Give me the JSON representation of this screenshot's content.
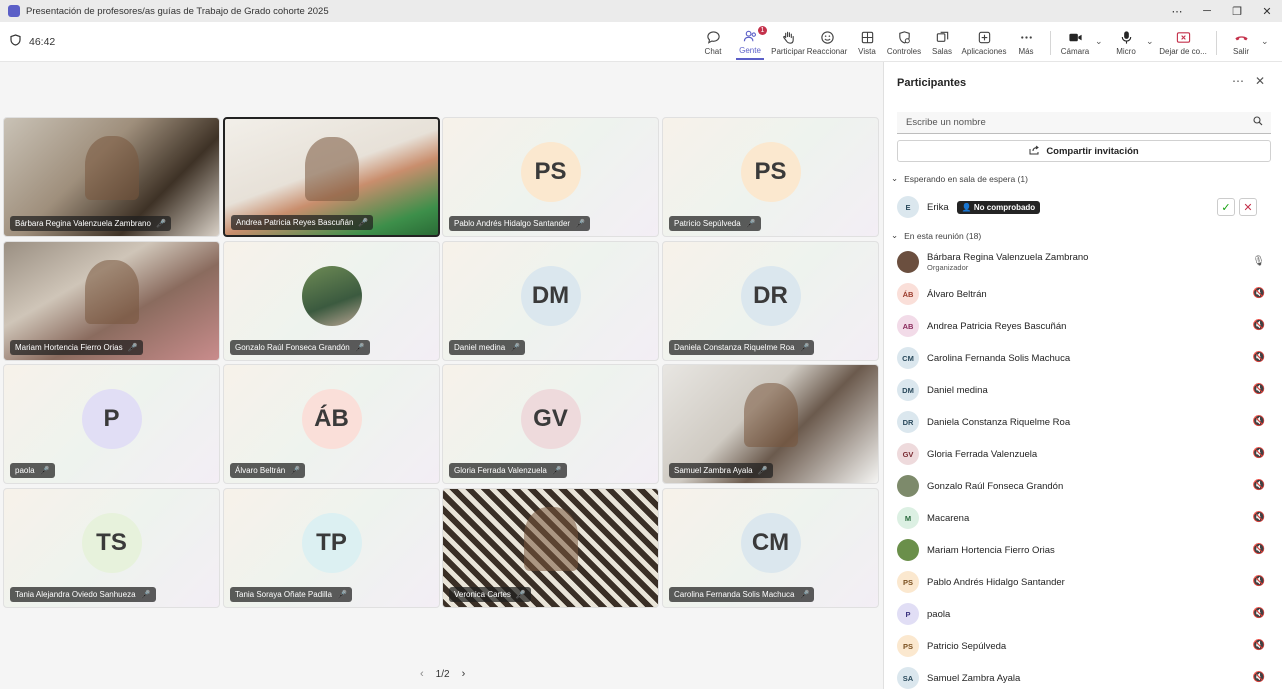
{
  "window": {
    "title": "Presentación de profesores/as guías de Trabajo de Grado cohorte 2025",
    "controls": [
      "⋯",
      "─",
      "❐",
      "✕"
    ]
  },
  "toolbar": {
    "timer": "46:42",
    "chat": "Chat",
    "people": "Gente",
    "people_badge": "1",
    "raise": "Participar",
    "react": "Reaccionar",
    "view": "Vista",
    "controls": "Controles",
    "rooms": "Salas",
    "apps": "Aplicaciones",
    "more": "Más",
    "camera": "Cámara",
    "mic": "Micro",
    "share": "Dejar de co...",
    "leave": "Salir"
  },
  "tiles": [
    {
      "name": "Bárbara Regina Valenzuela Zambrano",
      "initials": "",
      "color": "",
      "photo": "office"
    },
    {
      "name": "Andrea Patricia Reyes Bascuñán",
      "initials": "",
      "color": "",
      "photo": "woman1"
    },
    {
      "name": "Pablo Andrés Hidalgo Santander",
      "initials": "PS",
      "color": "#fbe8cf"
    },
    {
      "name": "Patricio Sepúlveda",
      "initials": "PS",
      "color": "#fbe8cf"
    },
    {
      "name": "Mariam Hortencia Fierro Orias",
      "initials": "",
      "color": "",
      "photo": "woman2"
    },
    {
      "name": "Gonzalo Raúl Fonseca Grandón",
      "initials": "",
      "color": "#e8f3ec",
      "photo": "avatarphoto"
    },
    {
      "name": "Daniel medina",
      "initials": "DM",
      "color": "#dbe7ee"
    },
    {
      "name": "Daniela Constanza Riquelme Roa",
      "initials": "DR",
      "color": "#dbe7ee"
    },
    {
      "name": "paola",
      "initials": "P",
      "color": "#e1def5"
    },
    {
      "name": "Álvaro Beltrán",
      "initials": "ÁB",
      "color": "#fadfd9"
    },
    {
      "name": "Gloria Ferrada Valenzuela",
      "initials": "GV",
      "color": "#eedadc"
    },
    {
      "name": "Samuel Zambra Ayala",
      "initials": "",
      "color": "",
      "photo": "man1"
    },
    {
      "name": "Tania Alejandra Oviedo Sanhueza",
      "initials": "TS",
      "color": "#e7f2dc"
    },
    {
      "name": "Tania Soraya Oñate Padilla",
      "initials": "TP",
      "color": "#dcf0f2"
    },
    {
      "name": "Veronica Cartes",
      "initials": "",
      "color": "",
      "photo": "woman3"
    },
    {
      "name": "Carolina Fernanda Solis Machuca",
      "initials": "CM",
      "color": "#dbe7ee"
    }
  ],
  "pager": {
    "label": "1/2"
  },
  "panel": {
    "title": "Participantes",
    "search_placeholder": "Escribe un nombre",
    "share_invite": "Compartir invitación",
    "waiting_section": "Esperando en sala de espera (1)",
    "waiting": {
      "initials": "E",
      "name": "Erika",
      "badge": "No comprobado"
    },
    "meeting_section": "En esta reunión (18)",
    "participants": [
      {
        "initials": "",
        "name": "Bárbara Regina Valenzuela Zambrano",
        "role": "Organizador",
        "color": "#6b4f3f",
        "photo": true
      },
      {
        "initials": "ÁB",
        "name": "Álvaro Beltrán",
        "color": "#fadfd9",
        "text": "#9a3a2c"
      },
      {
        "initials": "AB",
        "name": "Andrea Patricia Reyes Bascuñán",
        "color": "#f2dbe8",
        "text": "#8a2a5c"
      },
      {
        "initials": "CM",
        "name": "Carolina Fernanda Solis Machuca",
        "color": "#dbe7ee",
        "text": "#2a4a5c"
      },
      {
        "initials": "DM",
        "name": "Daniel medina",
        "color": "#dbe7ee",
        "text": "#2a4a5c"
      },
      {
        "initials": "DR",
        "name": "Daniela Constanza Riquelme Roa",
        "color": "#dbe7ee",
        "text": "#2a4a5c"
      },
      {
        "initials": "GV",
        "name": "Gloria Ferrada Valenzuela",
        "color": "#eedadc",
        "text": "#7a2a32"
      },
      {
        "initials": "",
        "name": "Gonzalo Raúl Fonseca Grandón",
        "color": "#7d8a6b",
        "photo": true
      },
      {
        "initials": "M",
        "name": "Macarena",
        "color": "#dcf0e3",
        "text": "#2a6b3e"
      },
      {
        "initials": "",
        "name": "Mariam Hortencia Fierro Orias",
        "color": "#6a8f4a",
        "photo": true
      },
      {
        "initials": "PS",
        "name": "Pablo Andrés Hidalgo Santander",
        "color": "#fbe8cf",
        "text": "#7a5020"
      },
      {
        "initials": "P",
        "name": "paola",
        "color": "#e1def5",
        "text": "#3d3580"
      },
      {
        "initials": "PS",
        "name": "Patricio Sepúlveda",
        "color": "#fbe8cf",
        "text": "#7a5020"
      },
      {
        "initials": "SA",
        "name": "Samuel Zambra Ayala",
        "color": "#dbe7ee",
        "text": "#2a4a5c"
      }
    ]
  }
}
